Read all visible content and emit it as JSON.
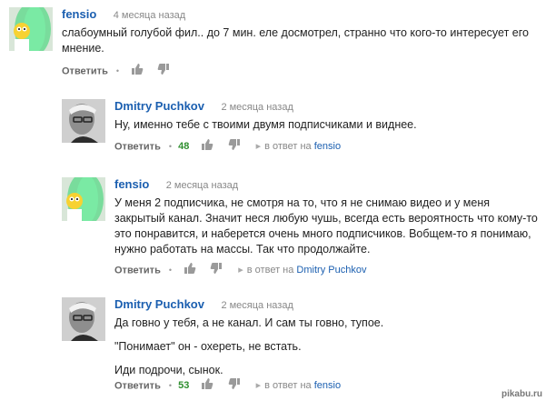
{
  "comments": [
    {
      "author": "fensio",
      "time": "4 месяца назад",
      "paragraphs": [
        "слабоумный голубой фил.. до 7 мин. еле досмотрел, странно что кого-то интересует его мнение."
      ],
      "reply_label": "Ответить",
      "likes": "",
      "in_reply_prefix": "",
      "in_reply_to": "",
      "avatar_icon": "simpson-avatar-icon"
    },
    {
      "author": "Dmitry Puchkov",
      "time": "2 месяца назад",
      "paragraphs": [
        "Ну, именно тебе с твоими двумя подписчиками и виднее."
      ],
      "reply_label": "Ответить",
      "likes": "48",
      "in_reply_prefix": "в ответ на",
      "in_reply_to": "fensio",
      "avatar_icon": "man-photo-avatar-icon"
    },
    {
      "author": "fensio",
      "time": "2 месяца назад",
      "paragraphs": [
        "У меня 2 подписчика, не смотря на то, что я не снимаю видео и у меня закрытый канал. Значит неся любую чушь, всегда есть вероятность что кому-то это понравится, и наберется очень много подписчиков. Вобщем-то я понимаю, нужно работать на массы. Так что продолжайте."
      ],
      "reply_label": "Ответить",
      "likes": "",
      "in_reply_prefix": "в ответ на",
      "in_reply_to": "Dmitry Puchkov",
      "avatar_icon": "simpson-avatar-icon"
    },
    {
      "author": "Dmitry Puchkov",
      "time": "2 месяца назад",
      "paragraphs": [
        "Да говно у тебя, а не канал. И сам ты говно, тупое.",
        "\"Понимает\" он - охереть, не встать.",
        "Иди подрочи, сынок."
      ],
      "reply_label": "Ответить",
      "likes": "53",
      "in_reply_prefix": "в ответ на",
      "in_reply_to": "fensio",
      "avatar_icon": "man-photo-avatar-icon"
    }
  ],
  "watermark": "pikabu.ru",
  "colors": {
    "link": "#1b5fb0",
    "likes": "#2f8f2f",
    "meta": "#888888"
  }
}
